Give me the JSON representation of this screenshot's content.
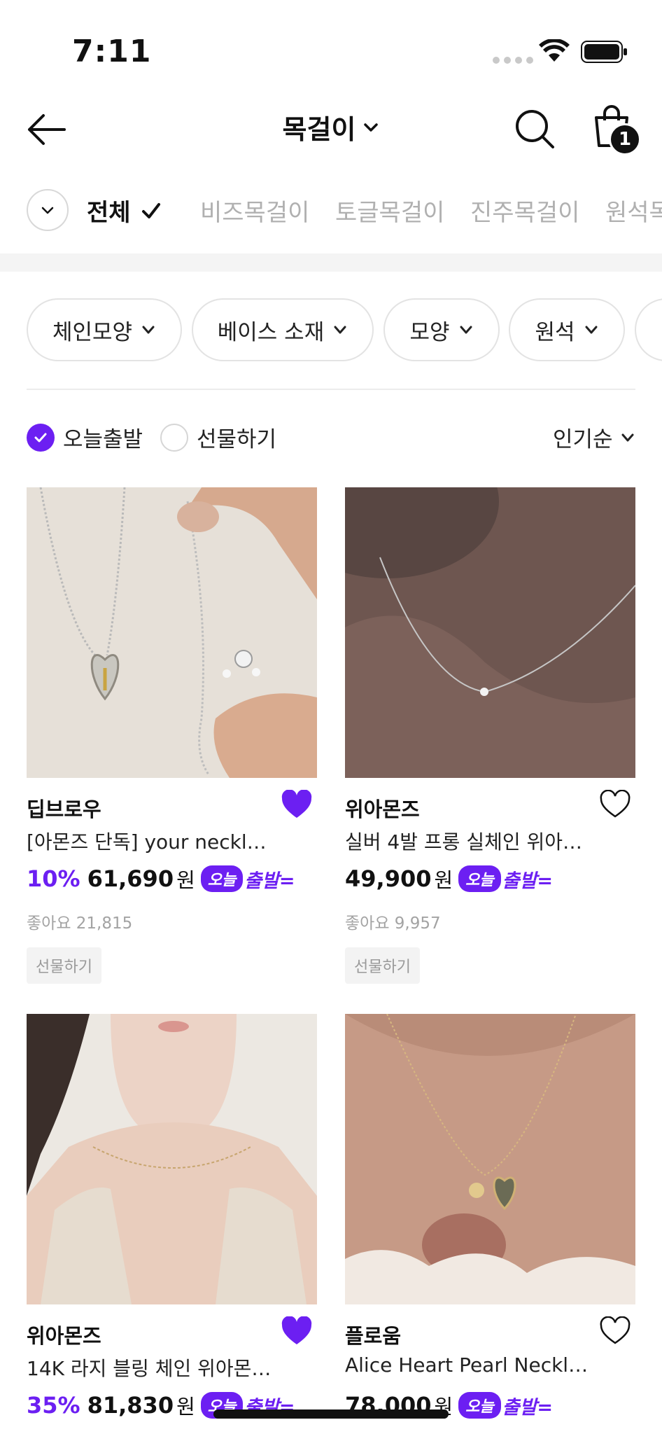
{
  "status_bar": {
    "time": "7:11",
    "icons": [
      "cellular-icon",
      "wifi-icon",
      "battery-icon"
    ]
  },
  "header": {
    "title": "목걸이",
    "cart_count": "1",
    "icons": [
      "back-arrow-icon",
      "search-icon",
      "shopping-bag-icon"
    ]
  },
  "categories": {
    "items": [
      {
        "label": "전체",
        "active": true
      },
      {
        "label": "비즈목걸이"
      },
      {
        "label": "토글목걸이"
      },
      {
        "label": "진주목걸이"
      },
      {
        "label": "원석목"
      }
    ]
  },
  "filters": {
    "chips": [
      {
        "label": "체인모양"
      },
      {
        "label": "베이스 소재"
      },
      {
        "label": "모양"
      },
      {
        "label": "원석"
      }
    ]
  },
  "options": {
    "today_ship": {
      "label": "오늘출발",
      "checked": true
    },
    "gift": {
      "label": "선물하기",
      "checked": false
    },
    "sort_label": "인기순"
  },
  "badges": {
    "oneul": "오늘",
    "departure": "출발="
  },
  "products": [
    {
      "brand": "딥브로우",
      "name": "[아몬즈 단독] your necklac…",
      "discount": "10%",
      "price": "61,690",
      "currency": "원",
      "likes": "좋아요 21,815",
      "gift": "선물하기",
      "liked": true
    },
    {
      "brand": "위아몬즈",
      "name": "실버 4발 프롱 실체인 위아…",
      "discount": "",
      "price": "49,900",
      "currency": "원",
      "likes": "좋아요 9,957",
      "gift": "선물하기",
      "liked": false
    },
    {
      "brand": "위아몬즈",
      "name": "14K 라지 블링 체인 위아몬…",
      "discount": "35%",
      "price": "81,830",
      "currency": "원",
      "liked": true
    },
    {
      "brand": "플로움",
      "name": "Alice Heart Pearl Necklace",
      "discount": "",
      "price": "78,000",
      "currency": "원",
      "liked": false
    }
  ],
  "colors": {
    "accent": "#6c1ff2",
    "text": "#111111",
    "muted": "#a3a3a3"
  }
}
